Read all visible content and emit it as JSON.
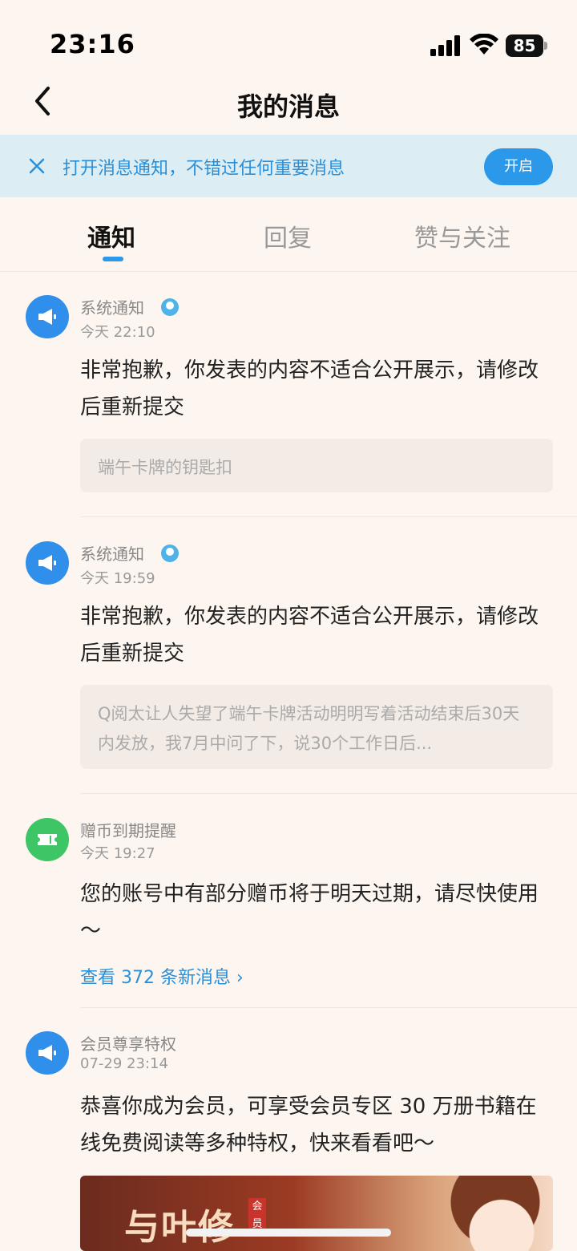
{
  "status_bar": {
    "time": "23:16",
    "battery": "85"
  },
  "header": {
    "title": "我的消息"
  },
  "notice_banner": {
    "text": "打开消息通知，不错过任何重要消息",
    "button": "开启"
  },
  "tabs": [
    {
      "label": "通知",
      "active": true
    },
    {
      "label": "回复",
      "active": false
    },
    {
      "label": "赞与关注",
      "active": false
    }
  ],
  "messages": [
    {
      "sender": "系统通知",
      "time": "今天 22:10",
      "icon": "megaphone-icon",
      "body": "非常抱歉，你发表的内容不适合公开展示，请修改后重新提交",
      "quote": "端午卡牌的钥匙扣"
    },
    {
      "sender": "系统通知",
      "time": "今天 19:59",
      "icon": "megaphone-icon",
      "body": "非常抱歉，你发表的内容不适合公开展示，请修改后重新提交",
      "quote": "Q阅太让人失望了端午卡牌活动明明写着活动结束后30天内发放，我7月中问了下，说30个工作日后..."
    },
    {
      "sender": "赠币到期提醒",
      "time": "今天 19:27",
      "icon": "ticket-icon",
      "body": "您的账号中有部分赠币将于明天过期，请尽快使用～",
      "link": "查看 372 条新消息 ›"
    },
    {
      "sender": "会员尊享特权",
      "time": "07-29 23:14",
      "icon": "megaphone-icon",
      "body": "恭喜你成为会员，可享受会员专区 30 万册书籍在线免费阅读等多种特权，快来看看吧～",
      "banner_text": "与叶修",
      "banner_badge": "会员"
    }
  ],
  "colors": {
    "accent": "#2b98ea",
    "background": "#fdf6f0",
    "banner_bg": "#dceef4"
  }
}
